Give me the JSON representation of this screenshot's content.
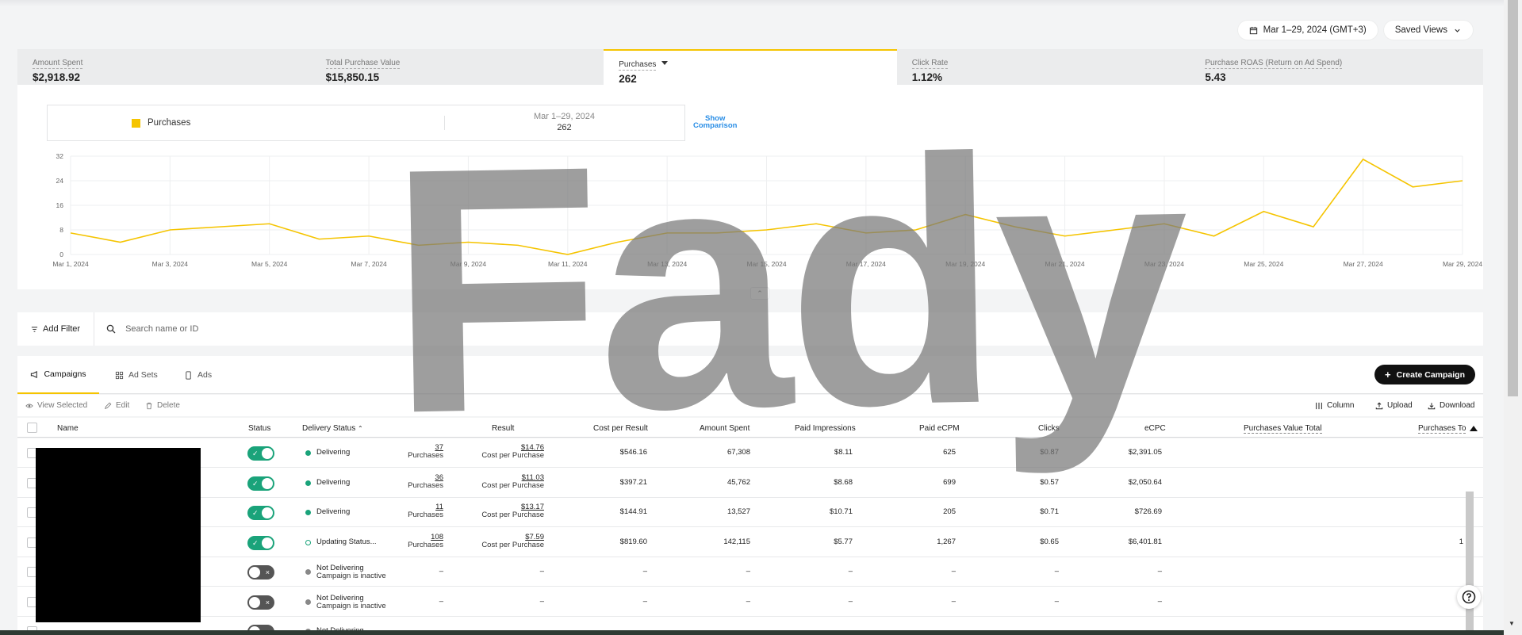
{
  "top_actions": {
    "date_range": "Mar 1–29, 2024 (GMT+3)",
    "saved_views": "Saved Views"
  },
  "metrics": [
    {
      "label": "Amount Spent",
      "value": "$2,918.92"
    },
    {
      "label": "Total Purchase Value",
      "value": "$15,850.15"
    },
    {
      "label": "Purchases",
      "value": "262"
    },
    {
      "label": "Click Rate",
      "value": "1.12%"
    },
    {
      "label": "Purchase ROAS (Return on Ad Spend)",
      "value": "5.43"
    }
  ],
  "legend": {
    "series": "Purchases",
    "date": "Mar 1–29, 2024",
    "total": "262",
    "compare_line1": "Show",
    "compare_line2": "Comparison"
  },
  "chart_data": {
    "type": "line",
    "x": [
      "Mar 1, 2024",
      "Mar 2, 2024",
      "Mar 3, 2024",
      "Mar 4, 2024",
      "Mar 5, 2024",
      "Mar 6, 2024",
      "Mar 7, 2024",
      "Mar 8, 2024",
      "Mar 9, 2024",
      "Mar 10, 2024",
      "Mar 11, 2024",
      "Mar 12, 2024",
      "Mar 13, 2024",
      "Mar 14, 2024",
      "Mar 15, 2024",
      "Mar 16, 2024",
      "Mar 17, 2024",
      "Mar 18, 2024",
      "Mar 19, 2024",
      "Mar 20, 2024",
      "Mar 21, 2024",
      "Mar 22, 2024",
      "Mar 23, 2024",
      "Mar 24, 2024",
      "Mar 25, 2024",
      "Mar 26, 2024",
      "Mar 27, 2024",
      "Mar 28, 2024",
      "Mar 29, 2024"
    ],
    "series": [
      {
        "name": "Purchases",
        "values": [
          7,
          4,
          8,
          9,
          10,
          5,
          6,
          3,
          4,
          3,
          0,
          4,
          7,
          7,
          8,
          10,
          7,
          8,
          13,
          9,
          6,
          8,
          10,
          6,
          14,
          9,
          31,
          22,
          24
        ]
      }
    ],
    "x_tick_labels": [
      "Mar 1, 2024",
      "Mar 3, 2024",
      "Mar 5, 2024",
      "Mar 7, 2024",
      "Mar 9, 2024",
      "Mar 11, 2024",
      "Mar 13, 2024",
      "Mar 15, 2024",
      "Mar 17, 2024",
      "Mar 19, 2024",
      "Mar 21, 2024",
      "Mar 23, 2024",
      "Mar 25, 2024",
      "Mar 27, 2024",
      "Mar 29, 2024"
    ],
    "y_ticks": [
      "0",
      "8",
      "16",
      "24",
      "32"
    ],
    "ylim": [
      0,
      32
    ],
    "grid": true,
    "color": "#f5c400"
  },
  "filter": {
    "add_filter": "Add Filter",
    "search_placeholder": "Search name or ID"
  },
  "tabs": [
    "Campaigns",
    "Ad Sets",
    "Ads"
  ],
  "create_button": "Create Campaign",
  "row_actions": {
    "view_selected": "View Selected",
    "edit": "Edit",
    "delete": "Delete",
    "column": "Column",
    "upload": "Upload",
    "download": "Download"
  },
  "columns": {
    "name": "Name",
    "status": "Status",
    "delivery": "Delivery Status",
    "result": "Result",
    "cpr": "Cost per Result",
    "spent": "Amount Spent",
    "impr": "Paid Impressions",
    "ecpm": "Paid eCPM",
    "clicks": "Clicks",
    "ecpc": "eCPC",
    "pvt": "Purchases Value Total",
    "pto": "Purchases To"
  },
  "rows": [
    {
      "on": true,
      "delivery": "Delivering",
      "delivery2": "",
      "dot": "green",
      "result": "37",
      "result_unit": "Purchases",
      "cpr": "$14.76",
      "cpr_unit": "Cost per Purchase",
      "spent": "$546.16",
      "impr": "67,308",
      "ecpm": "$8.11",
      "clicks": "625",
      "ecpc": "$0.87",
      "pvt": "$2,391.05",
      "pto": ""
    },
    {
      "on": true,
      "delivery": "Delivering",
      "delivery2": "",
      "dot": "green",
      "result": "36",
      "result_unit": "Purchases",
      "cpr": "$11.03",
      "cpr_unit": "Cost per Purchase",
      "spent": "$397.21",
      "impr": "45,762",
      "ecpm": "$8.68",
      "clicks": "699",
      "ecpc": "$0.57",
      "pvt": "$2,050.64",
      "pto": ""
    },
    {
      "on": true,
      "delivery": "Delivering",
      "delivery2": "",
      "dot": "green",
      "result": "11",
      "result_unit": "Purchases",
      "cpr": "$13.17",
      "cpr_unit": "Cost per Purchase",
      "spent": "$144.91",
      "impr": "13,527",
      "ecpm": "$10.71",
      "clicks": "205",
      "ecpc": "$0.71",
      "pvt": "$726.69",
      "pto": ""
    },
    {
      "on": true,
      "delivery": "Updating Status...",
      "delivery2": "",
      "dot": "ring",
      "result": "108",
      "result_unit": "Purchases",
      "cpr": "$7.59",
      "cpr_unit": "Cost per Purchase",
      "spent": "$819.60",
      "impr": "142,115",
      "ecpm": "$5.77",
      "clicks": "1,267",
      "ecpc": "$0.65",
      "pvt": "$6,401.81",
      "pto": "1"
    },
    {
      "on": false,
      "delivery": "Not Delivering",
      "delivery2": "Campaign is inactive",
      "dot": "grey",
      "result": "–",
      "result_unit": "",
      "cpr": "–",
      "cpr_unit": "",
      "spent": "–",
      "impr": "–",
      "ecpm": "–",
      "clicks": "–",
      "ecpc": "–",
      "pvt": "–",
      "pto": ""
    },
    {
      "on": false,
      "delivery": "Not Delivering",
      "delivery2": "Campaign is inactive",
      "dot": "grey",
      "result": "–",
      "result_unit": "",
      "cpr": "–",
      "cpr_unit": "",
      "spent": "–",
      "impr": "–",
      "ecpm": "–",
      "clicks": "–",
      "ecpc": "–",
      "pvt": "–",
      "pto": ""
    },
    {
      "on": false,
      "delivery": "Not Delivering",
      "delivery2": "",
      "dot": "grey",
      "result": "",
      "result_unit": "",
      "cpr": "",
      "cpr_unit": "",
      "spent": "",
      "impr": "",
      "ecpm": "",
      "clicks": "",
      "ecpc": "",
      "pvt": "",
      "pto": ""
    }
  ],
  "watermark": "Fady"
}
